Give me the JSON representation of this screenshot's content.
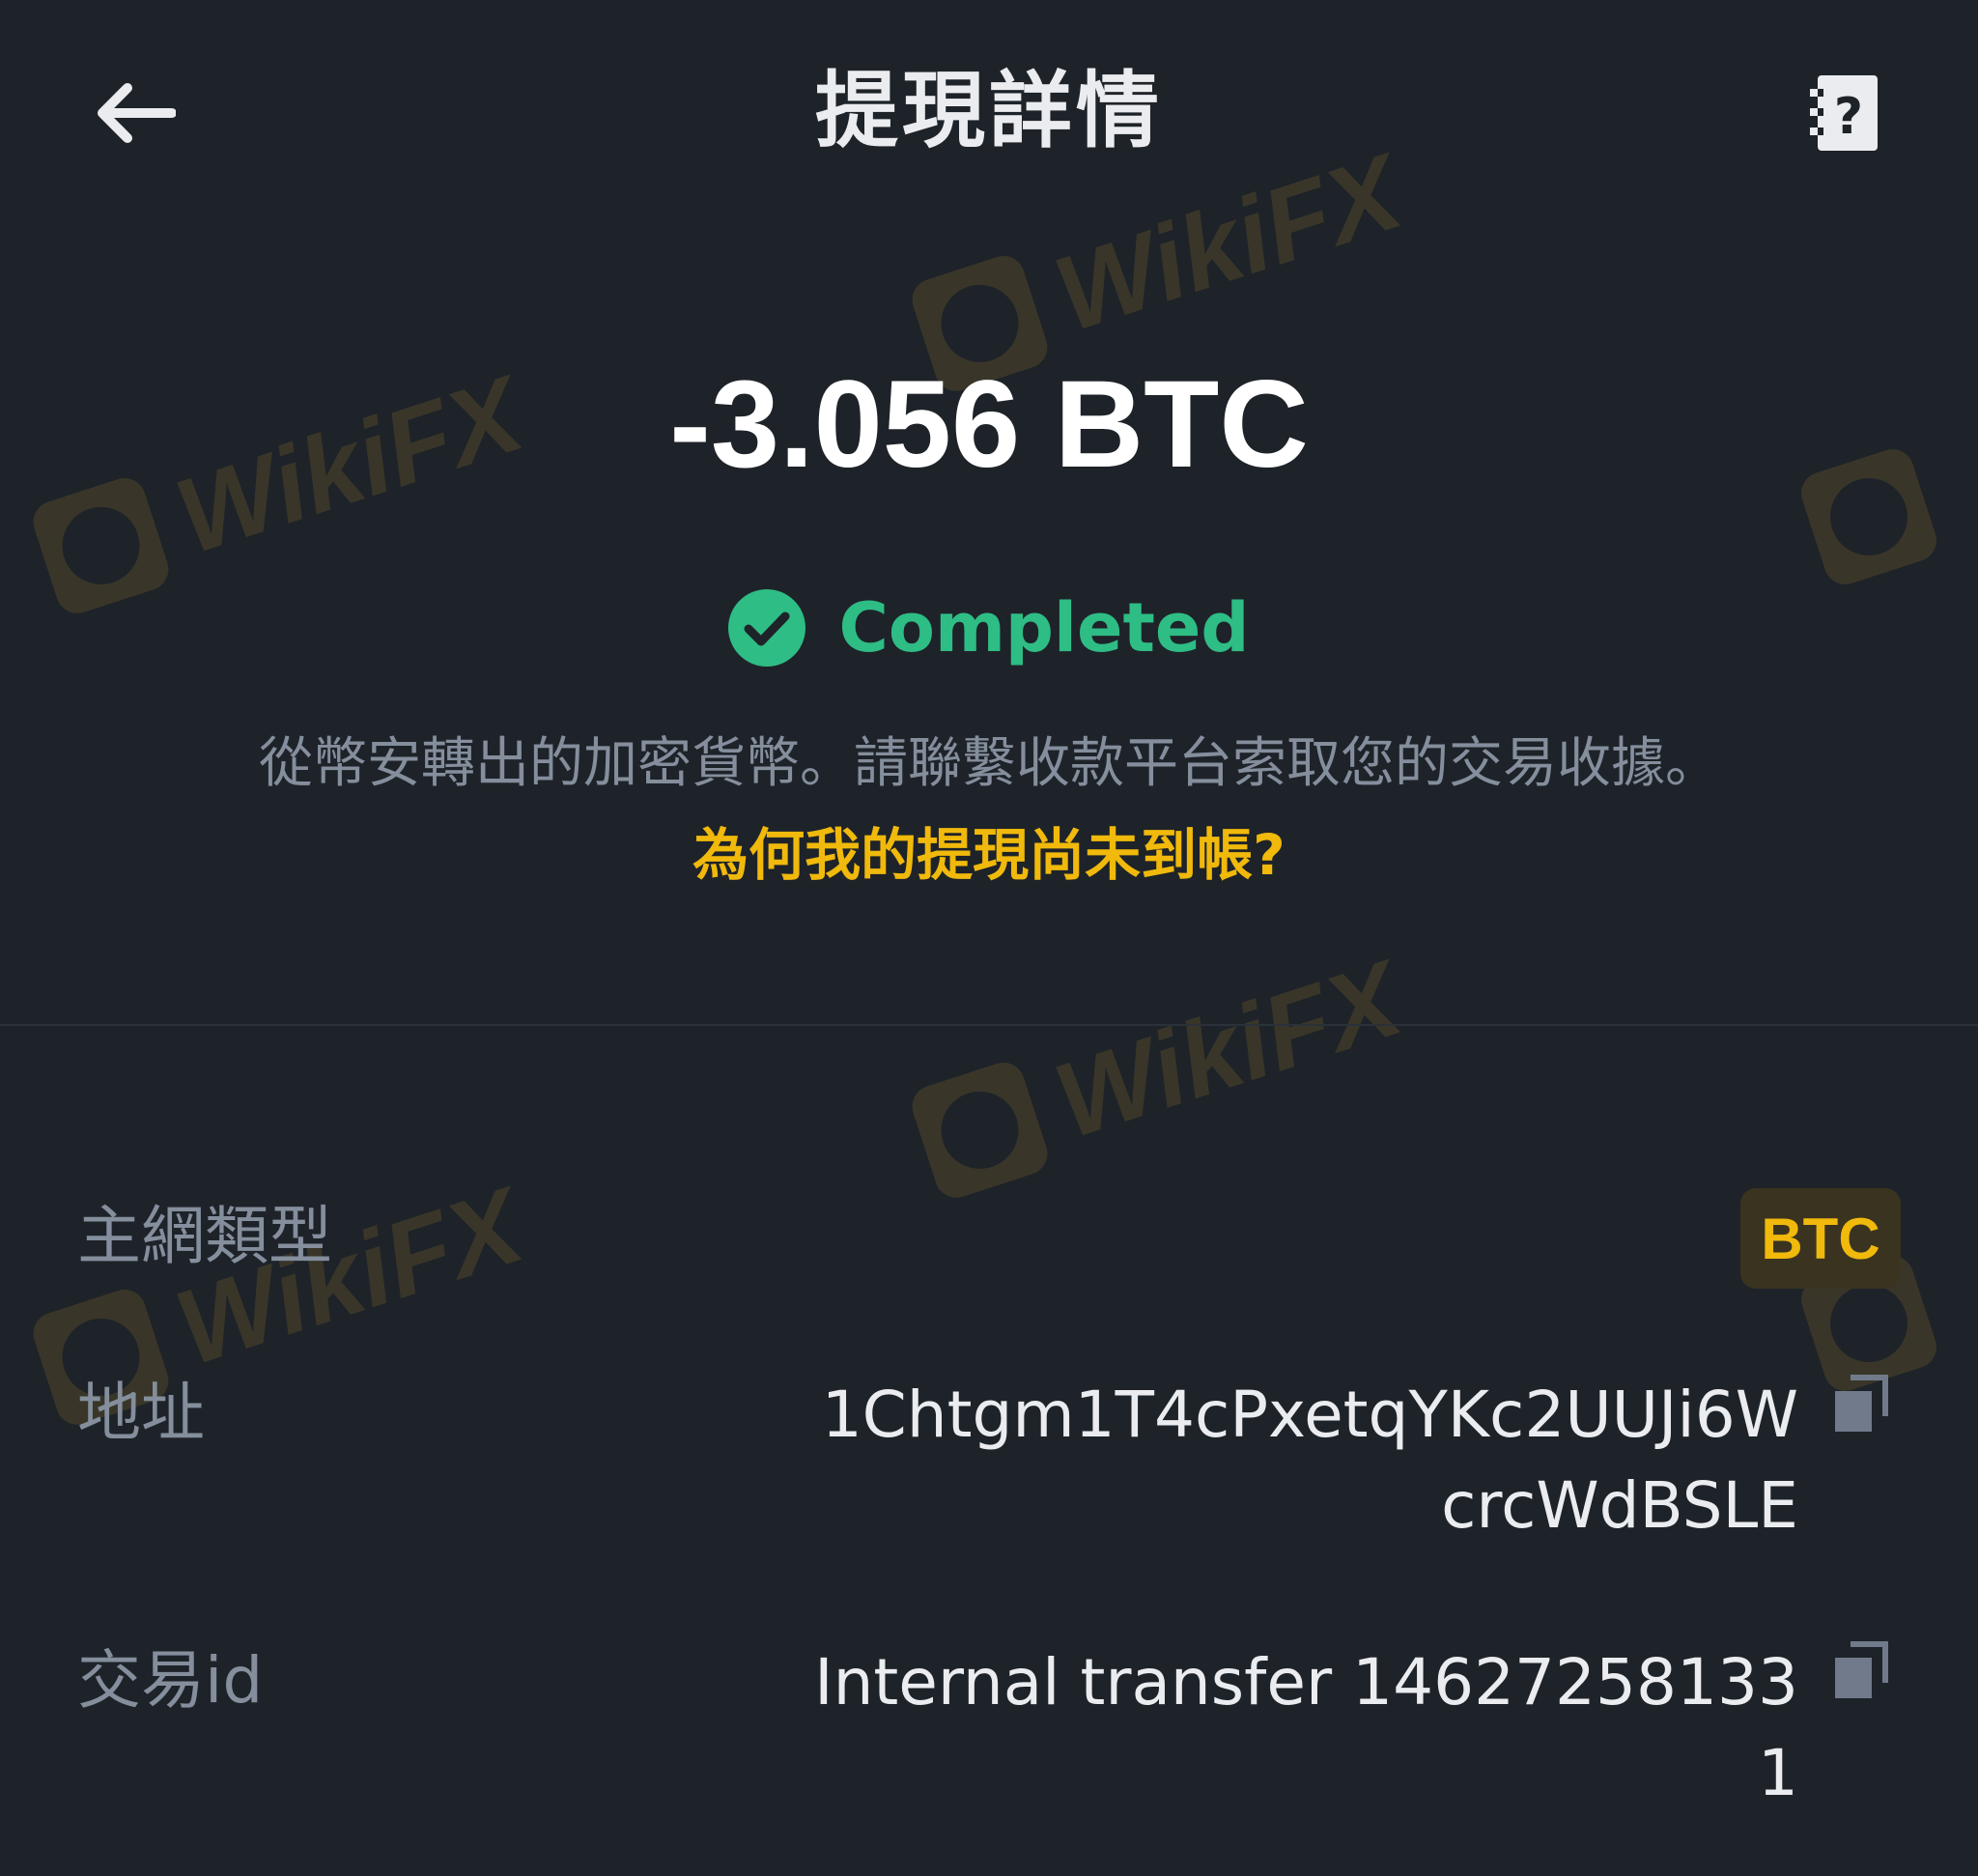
{
  "header": {
    "title": "提現詳情",
    "back_icon": "arrow-left-icon",
    "help_icon": "help-document-icon"
  },
  "summary": {
    "amount": "-3.056 BTC",
    "status": "Completed",
    "status_icon": "check-circle-icon",
    "description": "從幣安轉出的加密貨幣。請聯繫收款平台索取您的交易收據。",
    "faq_link": "為何我的提現尚未到帳?"
  },
  "details": {
    "network_label": "主網類型",
    "network_value": "BTC",
    "address_label": "地址",
    "address_value": "1Chtgm1T4cPxetqYKc2UUJi6W\ncrcWdBSLE",
    "txid_label": "交易id",
    "txid_value": "Internal transfer 14627258133\n1"
  },
  "watermark": {
    "text": "WikiFX"
  },
  "colors": {
    "background": "#1e2329",
    "success": "#2ebd85",
    "accent": "#f0b90b",
    "muted_text": "#848e9c",
    "primary_text": "#eaecef"
  }
}
